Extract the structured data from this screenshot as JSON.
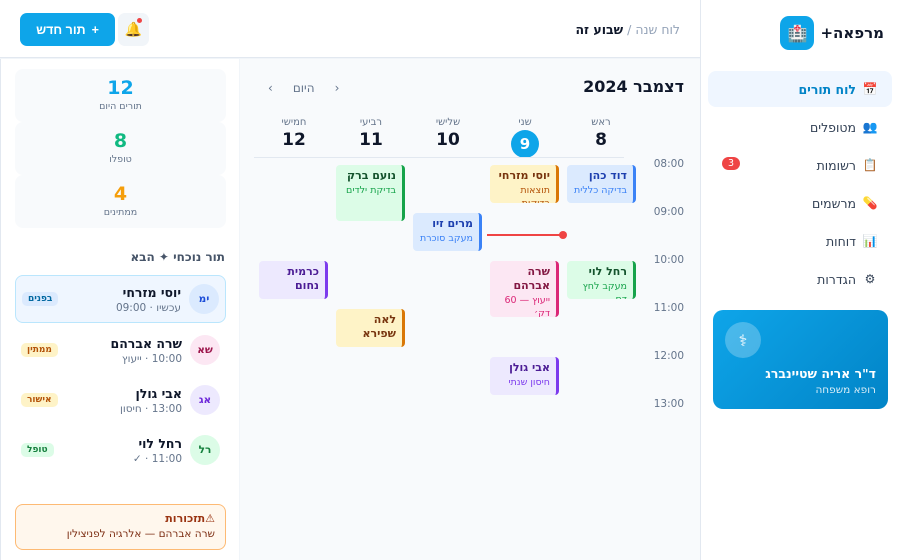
{
  "brand": {
    "name": "מרפאה+",
    "logo_icon": "🏥"
  },
  "nav": [
    {
      "label": "לוח תורים",
      "icon": "📅",
      "active": true
    },
    {
      "label": "מטופלים",
      "icon": "👥"
    },
    {
      "label": "רשומות",
      "icon": "📋",
      "badge": "3"
    },
    {
      "label": "מרשמים",
      "icon": "💊"
    },
    {
      "label": "דוחות",
      "icon": "📊"
    },
    {
      "label": "הגדרות",
      "icon": "⚙"
    }
  ],
  "doctor": {
    "icon": "⚕",
    "name": "ד\"ר אריה שטיינברג",
    "role": "רופא משפחה"
  },
  "topbar": {
    "crumb_root": "לוח שנה",
    "crumb_sep": "/",
    "crumb_current": "שבוע זה",
    "new_button": "תור חדש",
    "new_icon": "+",
    "bell_icon": "🔔"
  },
  "calendar": {
    "month": "דצמבר 2024",
    "nav": {
      "prev": "‹",
      "today": "היום",
      "next": "›"
    },
    "days": [
      {
        "name": "ראש",
        "num": "8"
      },
      {
        "name": "שני",
        "num": "9",
        "today": true
      },
      {
        "name": "שלישי",
        "num": "10"
      },
      {
        "name": "רביעי",
        "num": "11"
      },
      {
        "name": "חמישי",
        "num": "12"
      }
    ],
    "hours": [
      "08:00",
      "09:00",
      "10:00",
      "11:00",
      "12:00",
      "13:00"
    ],
    "appointments": [
      {
        "name": "דוד כהן",
        "desc": "בדיקה כללית"
      },
      {
        "name": "יוסי מזרחי",
        "desc": "תוצאות בדיקות"
      },
      {
        "name": "נועם ברק",
        "desc": "בדיקת ילדים"
      },
      {
        "name": "מרים זיו",
        "desc": "מעקב סוכרת"
      },
      {
        "name": "רחל לוי",
        "desc": "מעקב לחץ דם"
      },
      {
        "name": "שרה אברהם",
        "desc": "ייעוץ — 60 דק׳"
      },
      {
        "name": "כרמית נחום",
        "desc": ""
      },
      {
        "name": "לאה שפירא",
        "desc": ""
      },
      {
        "name": "אבי גולן",
        "desc": "חיסון שנתי"
      }
    ]
  },
  "stats": [
    {
      "value": "12",
      "label": "תורים היום",
      "color": "#0ea5e9"
    },
    {
      "value": "8",
      "label": "טופלו",
      "color": "#10b981"
    },
    {
      "value": "4",
      "label": "ממתינים",
      "color": "#f59e0b"
    }
  ],
  "queue": {
    "title": "תור נוכחי ✦ הבא",
    "items": [
      {
        "initials": "ימ",
        "name": "יוסי מזרחי",
        "sub": "עכשיו · 09:00",
        "badge": "בפנים"
      },
      {
        "initials": "שא",
        "name": "שרה אברהם",
        "sub": "10:00 · ייעוץ",
        "badge": "ממתין"
      },
      {
        "initials": "אג",
        "name": "אבי גולן",
        "sub": "13:00 · חיסון",
        "badge": "אישור"
      },
      {
        "initials": "רל",
        "name": "רחל לוי",
        "sub": "11:00 · ✓",
        "badge": "טופל"
      }
    ]
  },
  "reminder": {
    "icon": "⚠",
    "title": "תזכורות",
    "body": "שרה אברהם — אלרגיה לפניצילין"
  }
}
